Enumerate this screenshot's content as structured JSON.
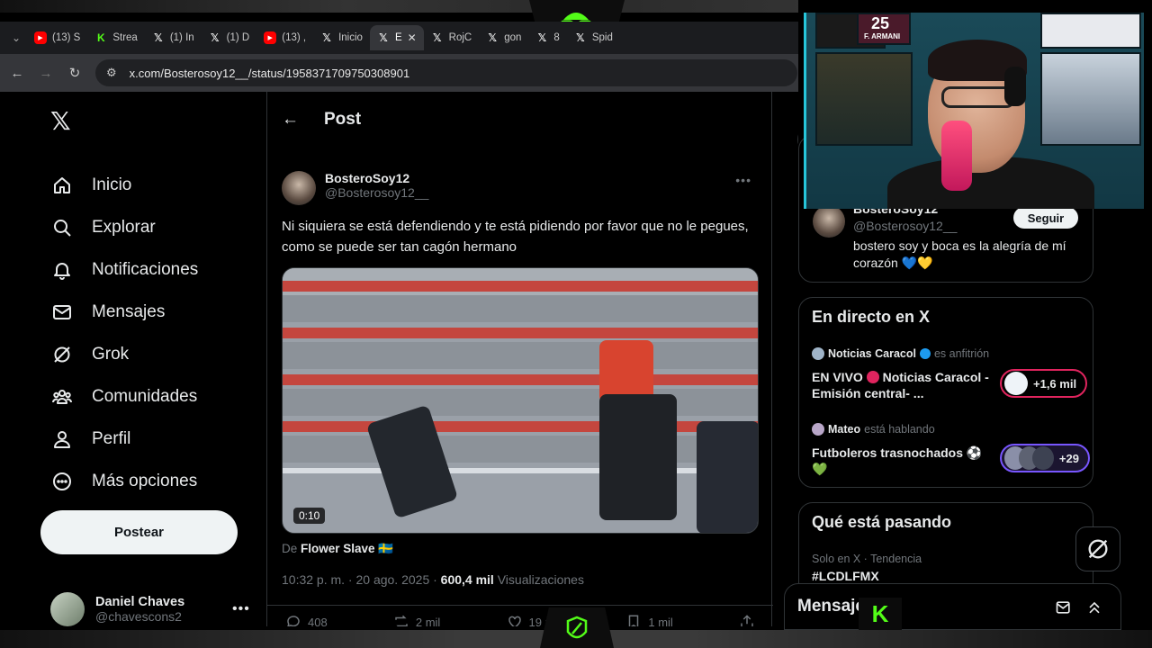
{
  "browser": {
    "tabs": [
      {
        "icon": "youtube-icon",
        "label": "(13) S"
      },
      {
        "icon": "kick-icon",
        "label": "Strea"
      },
      {
        "icon": "x-icon",
        "label": "(1) In"
      },
      {
        "icon": "x-icon",
        "label": "(1) D"
      },
      {
        "icon": "youtube-icon",
        "label": "(13) ,"
      },
      {
        "icon": "x-icon",
        "label": "Inicio"
      },
      {
        "icon": "x-icon",
        "label": "E",
        "active": true
      },
      {
        "icon": "x-icon",
        "label": "RojC"
      },
      {
        "icon": "x-icon",
        "label": "gon"
      },
      {
        "icon": "x-icon",
        "label": "8"
      },
      {
        "icon": "x-icon",
        "label": "Spid"
      }
    ],
    "url": "x.com/Bosterosoy12__/status/1958371709750308901"
  },
  "nav": {
    "items": [
      {
        "label": "Inicio",
        "icon": "home-icon"
      },
      {
        "label": "Explorar",
        "icon": "search-icon"
      },
      {
        "label": "Notificaciones",
        "icon": "bell-icon"
      },
      {
        "label": "Mensajes",
        "icon": "mail-icon"
      },
      {
        "label": "Grok",
        "icon": "grok-icon"
      },
      {
        "label": "Comunidades",
        "icon": "communities-icon"
      },
      {
        "label": "Perfil",
        "icon": "person-icon"
      },
      {
        "label": "Más opciones",
        "icon": "more-circle-icon"
      }
    ],
    "post_button": "Postear",
    "account": {
      "name": "Daniel Chaves",
      "handle": "@chavescons2"
    }
  },
  "post": {
    "header": "Post",
    "author": {
      "name": "BosteroSoy12",
      "handle": "@Bosterosoy12__"
    },
    "text": "Ni siquiera se está defendiendo y te está pidiendo por favor que no le pegues, como se puede ser tan cagón hermano",
    "video_duration": "0:10",
    "source_prefix": "De",
    "source_name": "Flower Slave 🇸🇪",
    "time": "10:32 p. m. · 20 ago. 2025 ·",
    "views": "600,4 mil",
    "views_label": "Visualizaciones",
    "replies": "408",
    "reposts": "2 mil",
    "likes": "19 mil",
    "bookmarks": "1 mil"
  },
  "sidebar": {
    "who": {
      "name": "BosteroSoy12",
      "handle": "@Bosterosoy12__",
      "follow": "Seguir",
      "bio": "bostero soy y boca es la alegría de mí corazón 💙💛"
    },
    "live": {
      "title": "En directo en X",
      "items": [
        {
          "host": "Noticias Caracol",
          "host_suffix": "es anfitrión",
          "title_pre": "EN VIVO",
          "title_post": "Noticias Caracol - Emisión central- ...",
          "count": "+1,6 mil",
          "accent": "#e0245e"
        },
        {
          "host": "Mateo",
          "host_suffix": "está hablando",
          "title_pre": "",
          "title_post": "Futboleros trasnochados ⚽💚",
          "count": "+29",
          "accent": "#7856ff"
        }
      ]
    },
    "trends": {
      "title": "Qué está pasando",
      "meta": "Solo en X · Tendencia",
      "tag": "#LCDLFMX"
    },
    "messages_title": "Mensaje"
  },
  "webcam": {
    "poster_text_1": "25",
    "poster_text_2": "F. ARMANI"
  }
}
